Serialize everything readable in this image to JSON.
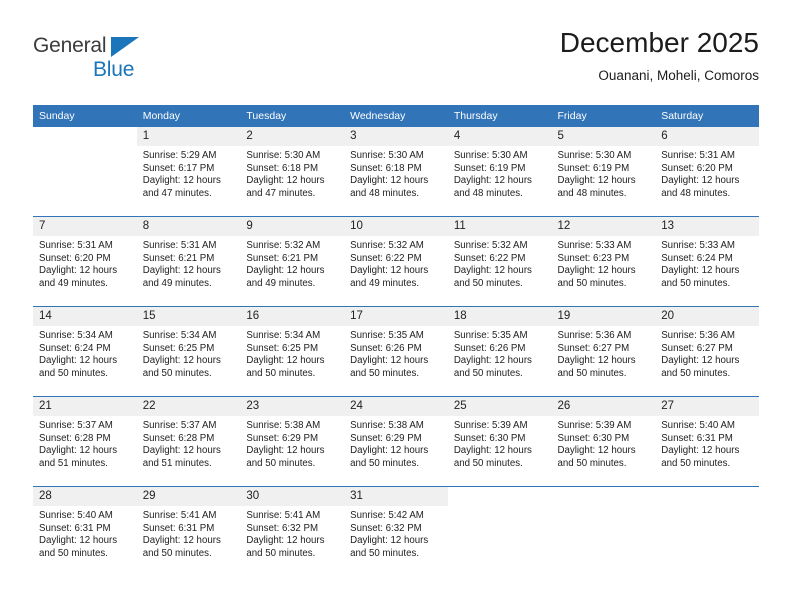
{
  "brand": {
    "name_part1": "General",
    "name_part2": "Blue",
    "triangle_icon": "triangle-icon",
    "accent_color": "#1b75bb"
  },
  "header": {
    "title": "December 2025",
    "subtitle": "Ouanani, Moheli, Comoros"
  },
  "colors": {
    "header_blue": "#3174b8",
    "daynum_gray": "#f0f0f0",
    "text": "#222222"
  },
  "weekdays": [
    "Sunday",
    "Monday",
    "Tuesday",
    "Wednesday",
    "Thursday",
    "Friday",
    "Saturday"
  ],
  "weeks": [
    [
      {
        "day": "",
        "sunrise": "",
        "sunset": "",
        "daylight_line1": "",
        "daylight_line2": ""
      },
      {
        "day": "1",
        "sunrise": "Sunrise: 5:29 AM",
        "sunset": "Sunset: 6:17 PM",
        "daylight_line1": "Daylight: 12 hours",
        "daylight_line2": "and 47 minutes."
      },
      {
        "day": "2",
        "sunrise": "Sunrise: 5:30 AM",
        "sunset": "Sunset: 6:18 PM",
        "daylight_line1": "Daylight: 12 hours",
        "daylight_line2": "and 47 minutes."
      },
      {
        "day": "3",
        "sunrise": "Sunrise: 5:30 AM",
        "sunset": "Sunset: 6:18 PM",
        "daylight_line1": "Daylight: 12 hours",
        "daylight_line2": "and 48 minutes."
      },
      {
        "day": "4",
        "sunrise": "Sunrise: 5:30 AM",
        "sunset": "Sunset: 6:19 PM",
        "daylight_line1": "Daylight: 12 hours",
        "daylight_line2": "and 48 minutes."
      },
      {
        "day": "5",
        "sunrise": "Sunrise: 5:30 AM",
        "sunset": "Sunset: 6:19 PM",
        "daylight_line1": "Daylight: 12 hours",
        "daylight_line2": "and 48 minutes."
      },
      {
        "day": "6",
        "sunrise": "Sunrise: 5:31 AM",
        "sunset": "Sunset: 6:20 PM",
        "daylight_line1": "Daylight: 12 hours",
        "daylight_line2": "and 48 minutes."
      }
    ],
    [
      {
        "day": "7",
        "sunrise": "Sunrise: 5:31 AM",
        "sunset": "Sunset: 6:20 PM",
        "daylight_line1": "Daylight: 12 hours",
        "daylight_line2": "and 49 minutes."
      },
      {
        "day": "8",
        "sunrise": "Sunrise: 5:31 AM",
        "sunset": "Sunset: 6:21 PM",
        "daylight_line1": "Daylight: 12 hours",
        "daylight_line2": "and 49 minutes."
      },
      {
        "day": "9",
        "sunrise": "Sunrise: 5:32 AM",
        "sunset": "Sunset: 6:21 PM",
        "daylight_line1": "Daylight: 12 hours",
        "daylight_line2": "and 49 minutes."
      },
      {
        "day": "10",
        "sunrise": "Sunrise: 5:32 AM",
        "sunset": "Sunset: 6:22 PM",
        "daylight_line1": "Daylight: 12 hours",
        "daylight_line2": "and 49 minutes."
      },
      {
        "day": "11",
        "sunrise": "Sunrise: 5:32 AM",
        "sunset": "Sunset: 6:22 PM",
        "daylight_line1": "Daylight: 12 hours",
        "daylight_line2": "and 50 minutes."
      },
      {
        "day": "12",
        "sunrise": "Sunrise: 5:33 AM",
        "sunset": "Sunset: 6:23 PM",
        "daylight_line1": "Daylight: 12 hours",
        "daylight_line2": "and 50 minutes."
      },
      {
        "day": "13",
        "sunrise": "Sunrise: 5:33 AM",
        "sunset": "Sunset: 6:24 PM",
        "daylight_line1": "Daylight: 12 hours",
        "daylight_line2": "and 50 minutes."
      }
    ],
    [
      {
        "day": "14",
        "sunrise": "Sunrise: 5:34 AM",
        "sunset": "Sunset: 6:24 PM",
        "daylight_line1": "Daylight: 12 hours",
        "daylight_line2": "and 50 minutes."
      },
      {
        "day": "15",
        "sunrise": "Sunrise: 5:34 AM",
        "sunset": "Sunset: 6:25 PM",
        "daylight_line1": "Daylight: 12 hours",
        "daylight_line2": "and 50 minutes."
      },
      {
        "day": "16",
        "sunrise": "Sunrise: 5:34 AM",
        "sunset": "Sunset: 6:25 PM",
        "daylight_line1": "Daylight: 12 hours",
        "daylight_line2": "and 50 minutes."
      },
      {
        "day": "17",
        "sunrise": "Sunrise: 5:35 AM",
        "sunset": "Sunset: 6:26 PM",
        "daylight_line1": "Daylight: 12 hours",
        "daylight_line2": "and 50 minutes."
      },
      {
        "day": "18",
        "sunrise": "Sunrise: 5:35 AM",
        "sunset": "Sunset: 6:26 PM",
        "daylight_line1": "Daylight: 12 hours",
        "daylight_line2": "and 50 minutes."
      },
      {
        "day": "19",
        "sunrise": "Sunrise: 5:36 AM",
        "sunset": "Sunset: 6:27 PM",
        "daylight_line1": "Daylight: 12 hours",
        "daylight_line2": "and 50 minutes."
      },
      {
        "day": "20",
        "sunrise": "Sunrise: 5:36 AM",
        "sunset": "Sunset: 6:27 PM",
        "daylight_line1": "Daylight: 12 hours",
        "daylight_line2": "and 50 minutes."
      }
    ],
    [
      {
        "day": "21",
        "sunrise": "Sunrise: 5:37 AM",
        "sunset": "Sunset: 6:28 PM",
        "daylight_line1": "Daylight: 12 hours",
        "daylight_line2": "and 51 minutes."
      },
      {
        "day": "22",
        "sunrise": "Sunrise: 5:37 AM",
        "sunset": "Sunset: 6:28 PM",
        "daylight_line1": "Daylight: 12 hours",
        "daylight_line2": "and 51 minutes."
      },
      {
        "day": "23",
        "sunrise": "Sunrise: 5:38 AM",
        "sunset": "Sunset: 6:29 PM",
        "daylight_line1": "Daylight: 12 hours",
        "daylight_line2": "and 50 minutes."
      },
      {
        "day": "24",
        "sunrise": "Sunrise: 5:38 AM",
        "sunset": "Sunset: 6:29 PM",
        "daylight_line1": "Daylight: 12 hours",
        "daylight_line2": "and 50 minutes."
      },
      {
        "day": "25",
        "sunrise": "Sunrise: 5:39 AM",
        "sunset": "Sunset: 6:30 PM",
        "daylight_line1": "Daylight: 12 hours",
        "daylight_line2": "and 50 minutes."
      },
      {
        "day": "26",
        "sunrise": "Sunrise: 5:39 AM",
        "sunset": "Sunset: 6:30 PM",
        "daylight_line1": "Daylight: 12 hours",
        "daylight_line2": "and 50 minutes."
      },
      {
        "day": "27",
        "sunrise": "Sunrise: 5:40 AM",
        "sunset": "Sunset: 6:31 PM",
        "daylight_line1": "Daylight: 12 hours",
        "daylight_line2": "and 50 minutes."
      }
    ],
    [
      {
        "day": "28",
        "sunrise": "Sunrise: 5:40 AM",
        "sunset": "Sunset: 6:31 PM",
        "daylight_line1": "Daylight: 12 hours",
        "daylight_line2": "and 50 minutes."
      },
      {
        "day": "29",
        "sunrise": "Sunrise: 5:41 AM",
        "sunset": "Sunset: 6:31 PM",
        "daylight_line1": "Daylight: 12 hours",
        "daylight_line2": "and 50 minutes."
      },
      {
        "day": "30",
        "sunrise": "Sunrise: 5:41 AM",
        "sunset": "Sunset: 6:32 PM",
        "daylight_line1": "Daylight: 12 hours",
        "daylight_line2": "and 50 minutes."
      },
      {
        "day": "31",
        "sunrise": "Sunrise: 5:42 AM",
        "sunset": "Sunset: 6:32 PM",
        "daylight_line1": "Daylight: 12 hours",
        "daylight_line2": "and 50 minutes."
      },
      {
        "day": "",
        "sunrise": "",
        "sunset": "",
        "daylight_line1": "",
        "daylight_line2": ""
      },
      {
        "day": "",
        "sunrise": "",
        "sunset": "",
        "daylight_line1": "",
        "daylight_line2": ""
      },
      {
        "day": "",
        "sunrise": "",
        "sunset": "",
        "daylight_line1": "",
        "daylight_line2": ""
      }
    ]
  ]
}
